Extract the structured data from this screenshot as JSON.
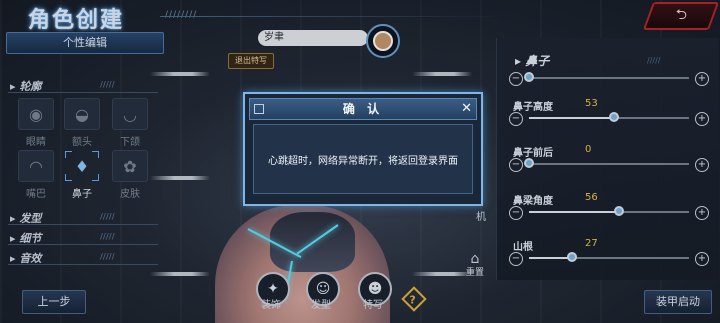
{
  "header": {
    "title": "角色创建",
    "back_icon": "return-arrow-icon"
  },
  "left_panel": {
    "tab_label": "个性编辑",
    "sections": {
      "contour": "轮廓",
      "hairstyle": "发型",
      "details": "细节",
      "voice": "音效"
    },
    "features": [
      {
        "label": "眼睛",
        "icon": "eye-icon"
      },
      {
        "label": "额头",
        "icon": "forehead-icon"
      },
      {
        "label": "下颌",
        "icon": "jaw-icon"
      },
      {
        "label": "嘴巴",
        "icon": "mouth-icon"
      },
      {
        "label": "鼻子",
        "icon": "nose-icon",
        "active": true
      },
      {
        "label": "皮肤",
        "icon": "skin-palette-icon"
      }
    ],
    "prev_label": "上一步"
  },
  "center": {
    "name_value": "岁聿",
    "feature_tag": "退出特写",
    "bottom_buttons": [
      "装饰",
      "发型",
      "特写"
    ],
    "reset_label": "重置",
    "side_label": "机"
  },
  "right_panel": {
    "title": "鼻子",
    "rows": [
      {
        "name": "鼻子高度",
        "value": "53",
        "fraction": 0.53
      },
      {
        "name": "鼻子前后",
        "value": "0",
        "fraction": 0.0
      },
      {
        "name": "鼻梁角度",
        "value": "56",
        "fraction": 0.56
      },
      {
        "name": "山根",
        "value": "27",
        "fraction": 0.27
      }
    ],
    "finish_label": "装甲启动"
  },
  "modal": {
    "title": "确 认",
    "message": "心跳超时，网络异常断开，将返回登录界面",
    "close_icon": "close-icon"
  },
  "colors": {
    "accent": "#7fb6e8",
    "value": "#f2c94c",
    "back_border": "#c0242c"
  }
}
